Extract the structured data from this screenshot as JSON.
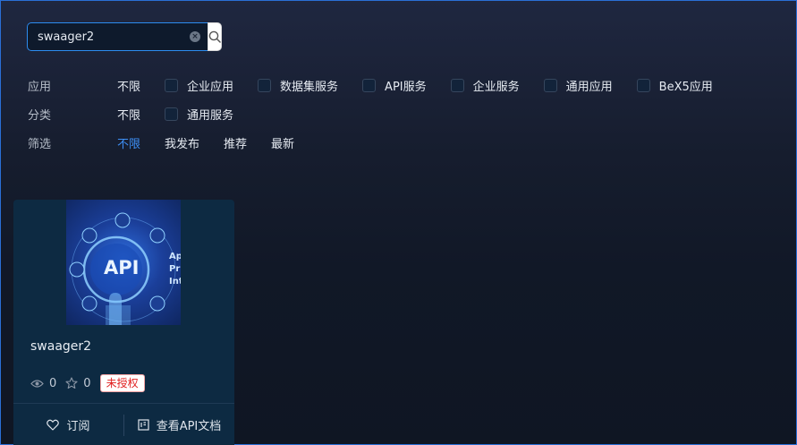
{
  "search": {
    "value": "swaager2"
  },
  "filters": {
    "app": {
      "label": "应用",
      "all": "不限",
      "options": [
        "企业应用",
        "数据集服务",
        "API服务",
        "企业服务",
        "通用应用",
        "BeX5应用"
      ]
    },
    "category": {
      "label": "分类",
      "all": "不限",
      "options": [
        "通用服务"
      ]
    },
    "sort": {
      "label": "筛选",
      "options": [
        "不限",
        "我发布",
        "推荐",
        "最新"
      ]
    }
  },
  "card": {
    "thumb_text": "API",
    "thumb_side_text": [
      "Ap",
      "Pr",
      "Int"
    ],
    "title": "swaager2",
    "views": "0",
    "stars": "0",
    "badge": "未授权",
    "subscribe": "订阅",
    "view_docs": "查看API文档"
  },
  "colors": {
    "accent": "#3d8ff5",
    "badge_text": "#e02020"
  }
}
